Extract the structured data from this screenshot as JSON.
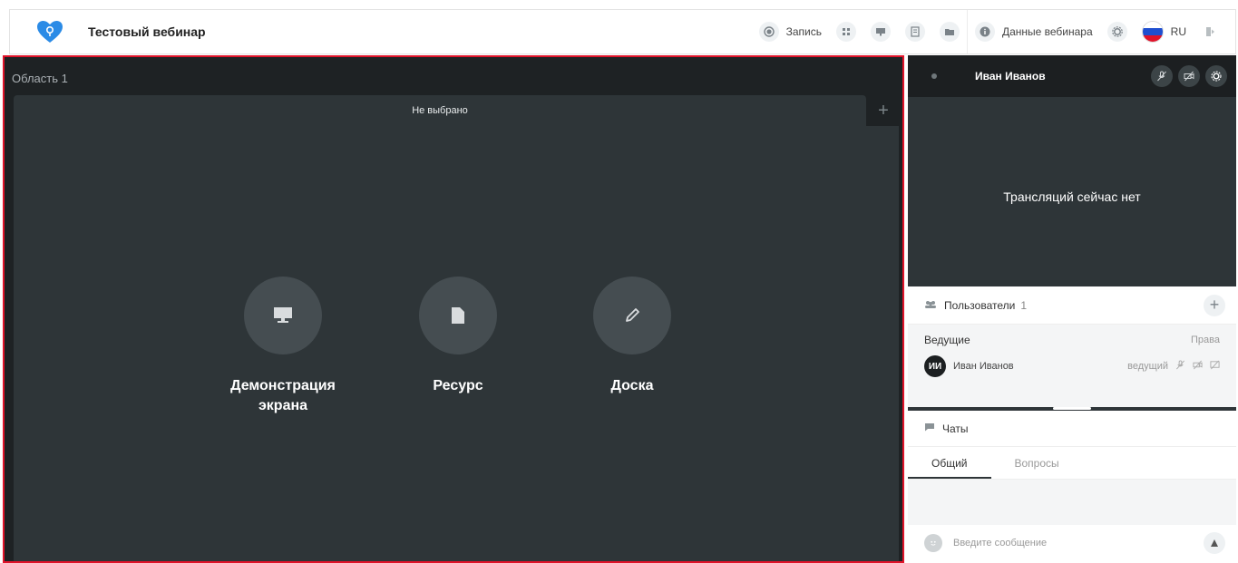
{
  "header": {
    "title": "Тестовый вебинар",
    "record_label": "Запись",
    "webinar_data_label": "Данные вебинара",
    "language": "RU"
  },
  "area": {
    "title": "Область 1",
    "tab_label": "Не выбрано",
    "options": [
      {
        "label": "Демонстрация экрана",
        "icon": "monitor-icon"
      },
      {
        "label": "Ресурс",
        "icon": "file-icon"
      },
      {
        "label": "Доска",
        "icon": "pencil-icon"
      }
    ]
  },
  "video": {
    "presenter_name": "Иван Иванов",
    "empty_message": "Трансляций сейчас нет"
  },
  "users": {
    "title": "Пользователи",
    "count": "1",
    "group_title": "Ведущие",
    "rights_label": "Права",
    "list": [
      {
        "initials": "ИИ",
        "name": "Иван Иванов",
        "role": "ведущий"
      }
    ]
  },
  "chats": {
    "title": "Чаты",
    "tabs": [
      "Общий",
      "Вопросы"
    ],
    "input_placeholder": "Введите сообщение"
  },
  "colors": {
    "highlight_border": "#e0132a",
    "dark_bg": "#1e2224",
    "stage_bg": "#2e3538",
    "logo_blue": "#2b8be6"
  }
}
